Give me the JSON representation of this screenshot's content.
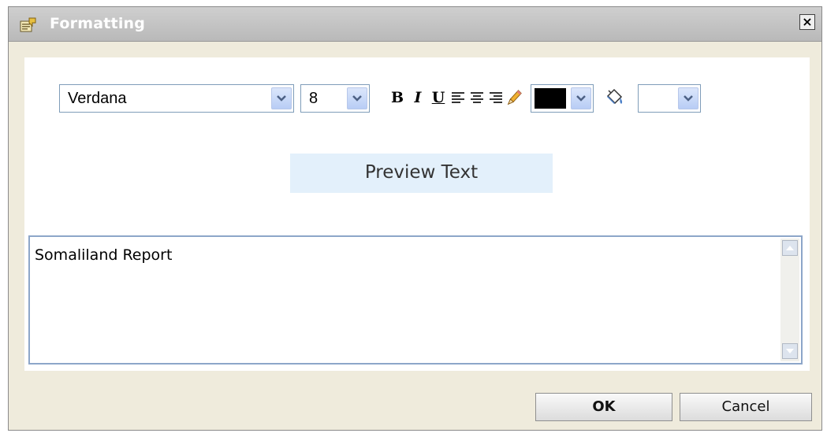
{
  "dialog": {
    "title": "Formatting",
    "close_label": "×"
  },
  "toolbar": {
    "font_family": "Verdana",
    "font_size": "8",
    "bold_label": "B",
    "italic_label": "I",
    "underline_label": "U",
    "text_color": "#000000",
    "background_color": "#ffffff",
    "icons": [
      "bold-icon",
      "italic-icon",
      "underline-icon",
      "align-left-icon",
      "align-center-icon",
      "align-right-icon",
      "pencil-icon",
      "paint-bucket-icon"
    ]
  },
  "preview": {
    "text": "Preview Text",
    "background": "#e3f0fb"
  },
  "editor": {
    "value": "Somaliland Report"
  },
  "buttons": {
    "ok_label": "OK",
    "cancel_label": "Cancel"
  }
}
